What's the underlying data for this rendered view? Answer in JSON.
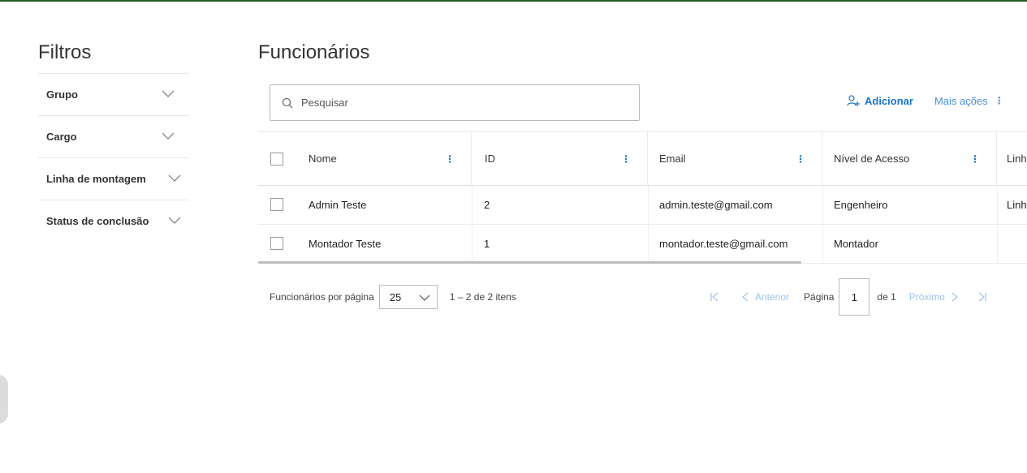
{
  "sidebar": {
    "title": "Filtros",
    "filters": [
      {
        "label": "Grupo"
      },
      {
        "label": "Cargo"
      },
      {
        "label": "Linha de montagem"
      },
      {
        "label": "Status de conclusão"
      }
    ]
  },
  "main": {
    "title": "Funcionários",
    "search": {
      "placeholder": "Pesquisar",
      "value": ""
    },
    "actions": {
      "add_label": "Adicionar",
      "more_label": "Mais ações"
    },
    "columns": [
      "Nome",
      "ID",
      "Email",
      "Nível de Acesso",
      "Linh"
    ],
    "rows": [
      {
        "nome": "Admin Teste",
        "id": "2",
        "email": "admin.teste@gmail.com",
        "nivel": "Engenheiro",
        "linha": "Linh"
      },
      {
        "nome": "Montador Teste",
        "id": "1",
        "email": "montador.teste@gmail.com",
        "nivel": "Montador",
        "linha": ""
      }
    ],
    "pagination": {
      "per_page_label": "Funcionários por página",
      "per_page_value": "25",
      "range_text": "1 – 2 de 2 itens",
      "previous_label": "Anterior",
      "page_label": "Página",
      "current_page": "1",
      "of_label": "de 1",
      "next_label": "Próximo"
    }
  },
  "colors": {
    "accent": "#1a73c9",
    "topbar": "#1b5e20",
    "muted_link": "#9fc3e8"
  }
}
